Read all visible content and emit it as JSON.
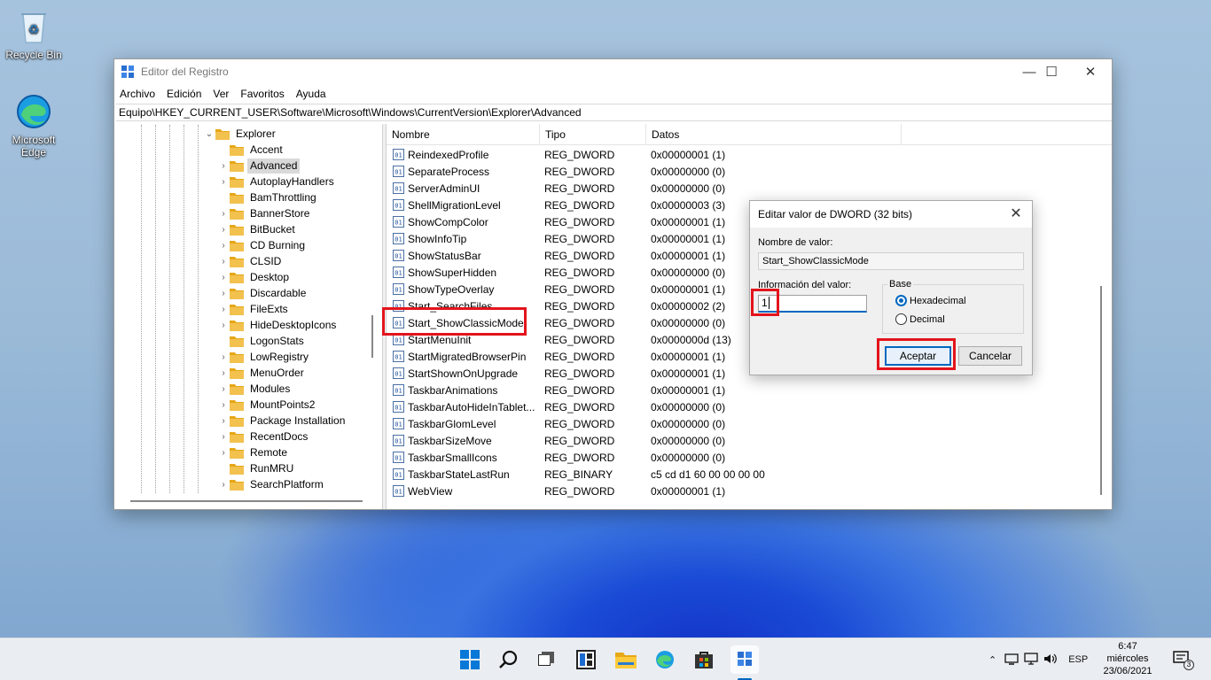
{
  "desktop": {
    "icons": [
      {
        "label": "Recycle Bin"
      },
      {
        "label": "Microsoft Edge"
      }
    ]
  },
  "window": {
    "title": "Editor del Registro",
    "menu": [
      "Archivo",
      "Edición",
      "Ver",
      "Favoritos",
      "Ayuda"
    ],
    "address": "Equipo\\HKEY_CURRENT_USER\\Software\\Microsoft\\Windows\\CurrentVersion\\Explorer\\Advanced",
    "controls": {
      "minimize": "—",
      "maximize": "☐",
      "close": "✕"
    }
  },
  "tree": {
    "parent": "Explorer",
    "selected": "Advanced",
    "items": [
      {
        "label": "Accent",
        "expandable": false
      },
      {
        "label": "Advanced",
        "expandable": true
      },
      {
        "label": "AutoplayHandlers",
        "expandable": true
      },
      {
        "label": "BamThrottling",
        "expandable": false
      },
      {
        "label": "BannerStore",
        "expandable": true
      },
      {
        "label": "BitBucket",
        "expandable": true
      },
      {
        "label": "CD Burning",
        "expandable": true
      },
      {
        "label": "CLSID",
        "expandable": true
      },
      {
        "label": "Desktop",
        "expandable": true
      },
      {
        "label": "Discardable",
        "expandable": true
      },
      {
        "label": "FileExts",
        "expandable": true
      },
      {
        "label": "HideDesktopIcons",
        "expandable": true
      },
      {
        "label": "LogonStats",
        "expandable": false
      },
      {
        "label": "LowRegistry",
        "expandable": true
      },
      {
        "label": "MenuOrder",
        "expandable": true
      },
      {
        "label": "Modules",
        "expandable": true
      },
      {
        "label": "MountPoints2",
        "expandable": true
      },
      {
        "label": "Package Installation",
        "expandable": true
      },
      {
        "label": "RecentDocs",
        "expandable": true
      },
      {
        "label": "Remote",
        "expandable": true
      },
      {
        "label": "RunMRU",
        "expandable": false
      },
      {
        "label": "SearchPlatform",
        "expandable": true
      }
    ]
  },
  "list": {
    "columns": [
      "Nombre",
      "Tipo",
      "Datos"
    ],
    "rows": [
      {
        "name": "ReindexedProfile",
        "type": "REG_DWORD",
        "data": "0x00000001 (1)"
      },
      {
        "name": "SeparateProcess",
        "type": "REG_DWORD",
        "data": "0x00000000 (0)"
      },
      {
        "name": "ServerAdminUI",
        "type": "REG_DWORD",
        "data": "0x00000000 (0)"
      },
      {
        "name": "ShellMigrationLevel",
        "type": "REG_DWORD",
        "data": "0x00000003 (3)"
      },
      {
        "name": "ShowCompColor",
        "type": "REG_DWORD",
        "data": "0x00000001 (1)"
      },
      {
        "name": "ShowInfoTip",
        "type": "REG_DWORD",
        "data": "0x00000001 (1)"
      },
      {
        "name": "ShowStatusBar",
        "type": "REG_DWORD",
        "data": "0x00000001 (1)"
      },
      {
        "name": "ShowSuperHidden",
        "type": "REG_DWORD",
        "data": "0x00000000 (0)"
      },
      {
        "name": "ShowTypeOverlay",
        "type": "REG_DWORD",
        "data": "0x00000001 (1)"
      },
      {
        "name": "Start_SearchFiles",
        "type": "REG_DWORD",
        "data": "0x00000002 (2)"
      },
      {
        "name": "Start_ShowClassicMode",
        "type": "REG_DWORD",
        "data": "0x00000000 (0)"
      },
      {
        "name": "StartMenuInit",
        "type": "REG_DWORD",
        "data": "0x0000000d (13)"
      },
      {
        "name": "StartMigratedBrowserPin",
        "type": "REG_DWORD",
        "data": "0x00000001 (1)"
      },
      {
        "name": "StartShownOnUpgrade",
        "type": "REG_DWORD",
        "data": "0x00000001 (1)"
      },
      {
        "name": "TaskbarAnimations",
        "type": "REG_DWORD",
        "data": "0x00000001 (1)"
      },
      {
        "name": "TaskbarAutoHideInTablet...",
        "type": "REG_DWORD",
        "data": "0x00000000 (0)"
      },
      {
        "name": "TaskbarGlomLevel",
        "type": "REG_DWORD",
        "data": "0x00000000 (0)"
      },
      {
        "name": "TaskbarSizeMove",
        "type": "REG_DWORD",
        "data": "0x00000000 (0)"
      },
      {
        "name": "TaskbarSmallIcons",
        "type": "REG_DWORD",
        "data": "0x00000000 (0)"
      },
      {
        "name": "TaskbarStateLastRun",
        "type": "REG_BINARY",
        "data": "c5 cd d1 60 00 00 00 00"
      },
      {
        "name": "WebView",
        "type": "REG_DWORD",
        "data": "0x00000001 (1)"
      }
    ]
  },
  "dialog": {
    "title": "Editar valor de DWORD (32 bits)",
    "close": "✕",
    "name_label": "Nombre de valor:",
    "name_value": "Start_ShowClassicMode",
    "value_label": "Información del valor:",
    "value": "1",
    "base_label": "Base",
    "hex_label": "Hexadecimal",
    "dec_label": "Decimal",
    "base_selected": "Hexadecimal",
    "ok": "Aceptar",
    "cancel": "Cancelar"
  },
  "taskbar": {
    "icons": [
      "start-icon",
      "search-icon",
      "task-view-icon",
      "widgets-icon",
      "file-explorer-icon",
      "edge-icon",
      "store-icon",
      "regedit-icon"
    ],
    "language": "ESP",
    "time": "6:47",
    "day": "miércoles",
    "date": "23/06/2021",
    "notifications": "3"
  },
  "colors": {
    "accent": "#0067c0",
    "highlight": "#e3141c",
    "folder": "#f2c14e"
  }
}
